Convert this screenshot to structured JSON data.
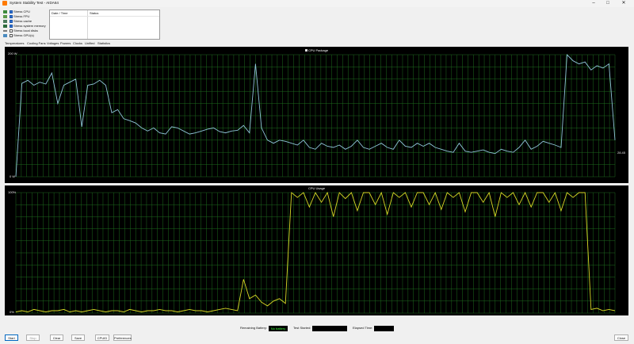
{
  "window": {
    "title": "System Stability Test - AIDA64"
  },
  "options": [
    {
      "label": "Stress CPU",
      "checked": true,
      "icon": "cpu-icon"
    },
    {
      "label": "Stress FPU",
      "checked": true,
      "icon": "fpu-icon"
    },
    {
      "label": "Stress cache",
      "checked": true,
      "icon": "cache-icon"
    },
    {
      "label": "Stress system memory",
      "checked": true,
      "icon": "memory-icon"
    },
    {
      "label": "Stress local disks",
      "checked": false,
      "icon": "disk-icon"
    },
    {
      "label": "Stress GPU(s)",
      "checked": false,
      "icon": "gpu-icon"
    }
  ],
  "log": {
    "col_date": "Date / Time",
    "col_status": "Status"
  },
  "tabs": [
    {
      "label": "Temperatures",
      "active": false
    },
    {
      "label": "Cooling Fans",
      "active": false
    },
    {
      "label": "Voltages",
      "active": false
    },
    {
      "label": "Powers",
      "active": true
    },
    {
      "label": "Clocks",
      "active": false
    },
    {
      "label": "Unified",
      "active": false
    },
    {
      "label": "Statistics",
      "active": false
    }
  ],
  "chart_data": [
    {
      "type": "line",
      "title": "CPU Package",
      "legend_checked": true,
      "ylim": [
        0,
        200
      ],
      "ytick_top": "200 W",
      "ytick_bottom": "0 W",
      "current_value": "28.45",
      "grid": true,
      "color": "#8fc4d8",
      "grid_color": "#1e6b1e",
      "x": [
        0,
        1,
        2,
        3,
        4,
        5,
        6,
        7,
        8,
        9,
        10,
        11,
        12,
        13,
        14,
        15,
        16,
        17,
        18,
        19,
        20,
        21,
        22,
        23,
        24,
        25,
        26,
        27,
        28,
        29,
        30,
        31,
        32,
        33,
        34,
        35,
        36,
        37,
        38,
        39,
        40,
        41,
        42,
        43,
        44,
        45,
        46,
        47,
        48,
        49,
        50,
        51,
        52,
        53,
        54,
        55,
        56,
        57,
        58,
        59,
        60,
        61,
        62,
        63,
        64,
        65,
        66,
        67,
        68,
        69,
        70,
        71,
        72,
        73,
        74,
        75,
        76,
        77,
        78,
        79,
        80,
        81,
        82,
        83,
        84,
        85,
        86,
        87,
        88,
        89,
        90,
        91,
        92,
        93,
        94,
        95,
        96,
        97,
        98,
        99,
        100
      ],
      "y": [
        0,
        153,
        158,
        150,
        155,
        152,
        170,
        120,
        150,
        155,
        160,
        82,
        150,
        152,
        158,
        150,
        105,
        110,
        95,
        92,
        88,
        80,
        75,
        80,
        72,
        70,
        82,
        80,
        75,
        70,
        72,
        75,
        78,
        80,
        74,
        72,
        75,
        76,
        84,
        72,
        185,
        80,
        60,
        55,
        60,
        58,
        55,
        52,
        60,
        48,
        45,
        55,
        50,
        48,
        52,
        45,
        50,
        60,
        48,
        45,
        50,
        55,
        48,
        45,
        60,
        50,
        48,
        55,
        50,
        55,
        48,
        45,
        42,
        40,
        55,
        42,
        40,
        42,
        44,
        40,
        38,
        45,
        42,
        40,
        48,
        60,
        45,
        50,
        58,
        55,
        52,
        48,
        200,
        190,
        185,
        188,
        175,
        182,
        178,
        185,
        60
      ]
    },
    {
      "type": "line",
      "title": "CPU Usage",
      "ylim": [
        0,
        100
      ],
      "ytick_top": "100%",
      "ytick_bottom": "0%",
      "grid": true,
      "color": "#d8d826",
      "grid_color": "#1e6b1e",
      "x": [
        0,
        1,
        2,
        3,
        4,
        5,
        6,
        7,
        8,
        9,
        10,
        11,
        12,
        13,
        14,
        15,
        16,
        17,
        18,
        19,
        20,
        21,
        22,
        23,
        24,
        25,
        26,
        27,
        28,
        29,
        30,
        31,
        32,
        33,
        34,
        35,
        36,
        37,
        38,
        39,
        40,
        41,
        42,
        43,
        44,
        45,
        46,
        47,
        48,
        49,
        50,
        51,
        52,
        53,
        54,
        55,
        56,
        57,
        58,
        59,
        60,
        61,
        62,
        63,
        64,
        65,
        66,
        67,
        68,
        69,
        70,
        71,
        72,
        73,
        74,
        75,
        76,
        77,
        78,
        79,
        80,
        81,
        82,
        83,
        84,
        85,
        86,
        87,
        88,
        89,
        90,
        91,
        92,
        93,
        94,
        95,
        96,
        97,
        98,
        99,
        100
      ],
      "y": [
        1,
        2,
        1,
        3,
        2,
        1,
        2,
        2,
        3,
        1,
        2,
        1,
        2,
        3,
        2,
        1,
        2,
        2,
        1,
        3,
        2,
        1,
        2,
        2,
        3,
        2,
        2,
        1,
        2,
        3,
        2,
        2,
        1,
        2,
        3,
        4,
        3,
        2,
        28,
        12,
        15,
        9,
        6,
        10,
        12,
        8,
        100,
        96,
        100,
        88,
        100,
        92,
        100,
        80,
        100,
        95,
        100,
        85,
        100,
        100,
        90,
        100,
        82,
        100,
        96,
        100,
        88,
        100,
        100,
        90,
        100,
        86,
        100,
        96,
        100,
        84,
        100,
        100,
        92,
        100,
        80,
        100,
        96,
        100,
        90,
        100,
        88,
        100,
        100,
        92,
        100,
        85,
        100,
        96,
        100,
        100,
        3,
        4,
        2,
        3,
        2
      ]
    }
  ],
  "status": {
    "remaining_battery_label": "Remaining Battery:",
    "remaining_battery_value": "No battery",
    "test_started_label": "Test Started:",
    "test_started_value": "",
    "elapsed_time_label": "Elapsed Time:",
    "elapsed_time_value": ""
  },
  "buttons": {
    "start": "Start",
    "stop": "Stop",
    "clear": "Clear",
    "save": "Save",
    "cpuid": "CPUID",
    "preferences": "Preferences",
    "close": "Close"
  }
}
